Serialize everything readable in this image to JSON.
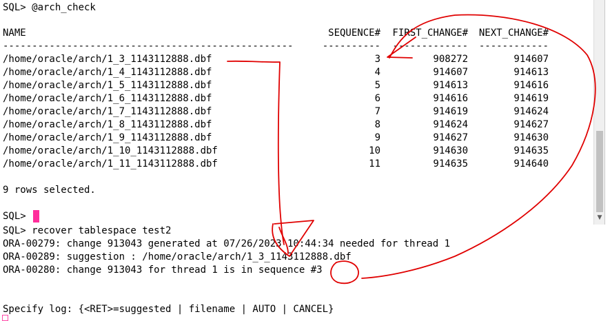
{
  "pane_top": {
    "prompt_command": "SQL> @arch_check",
    "header": {
      "name": "NAME",
      "sequence": "SEQUENCE#",
      "first_change": "FIRST_CHANGE#",
      "next_change": "NEXT_CHANGE#"
    },
    "separator": {
      "name": "--------------------------------------------------",
      "sequence": "----------",
      "first_change": "-------------",
      "next_change": "------------"
    },
    "rows": [
      {
        "name": "/home/oracle/arch/1_3_1143112888.dbf",
        "sequence": "3",
        "first_change": "908272",
        "next_change": "914607"
      },
      {
        "name": "/home/oracle/arch/1_4_1143112888.dbf",
        "sequence": "4",
        "first_change": "914607",
        "next_change": "914613"
      },
      {
        "name": "/home/oracle/arch/1_5_1143112888.dbf",
        "sequence": "5",
        "first_change": "914613",
        "next_change": "914616"
      },
      {
        "name": "/home/oracle/arch/1_6_1143112888.dbf",
        "sequence": "6",
        "first_change": "914616",
        "next_change": "914619"
      },
      {
        "name": "/home/oracle/arch/1_7_1143112888.dbf",
        "sequence": "7",
        "first_change": "914619",
        "next_change": "914624"
      },
      {
        "name": "/home/oracle/arch/1_8_1143112888.dbf",
        "sequence": "8",
        "first_change": "914624",
        "next_change": "914627"
      },
      {
        "name": "/home/oracle/arch/1_9_1143112888.dbf",
        "sequence": "9",
        "first_change": "914627",
        "next_change": "914630"
      },
      {
        "name": "/home/oracle/arch/1_10_1143112888.dbf",
        "sequence": "10",
        "first_change": "914630",
        "next_change": "914635"
      },
      {
        "name": "/home/oracle/arch/1_11_1143112888.dbf",
        "sequence": "11",
        "first_change": "914635",
        "next_change": "914640"
      }
    ],
    "rows_selected": "9 rows selected.",
    "prompt": "SQL>"
  },
  "pane_bottom": {
    "lines": [
      "SQL> recover tablespace test2",
      "ORA-00279: change 913043 generated at 07/26/2023 10:44:34 needed for thread 1",
      "ORA-00289: suggestion : /home/oracle/arch/1_3_1143112888.dbf",
      "ORA-00280: change 913043 for thread 1 is in sequence #3",
      "",
      "Specify log: {<RET>=suggested | filename | AUTO | CANCEL}"
    ]
  },
  "colors": {
    "cursor": "#ff2d9b",
    "annotation": "#e00000",
    "scrollbar_track": "#f0f0f0",
    "scrollbar_thumb": "#c1c1c1"
  },
  "icons": {
    "scroll_down": "scroll-down-arrow-icon"
  }
}
